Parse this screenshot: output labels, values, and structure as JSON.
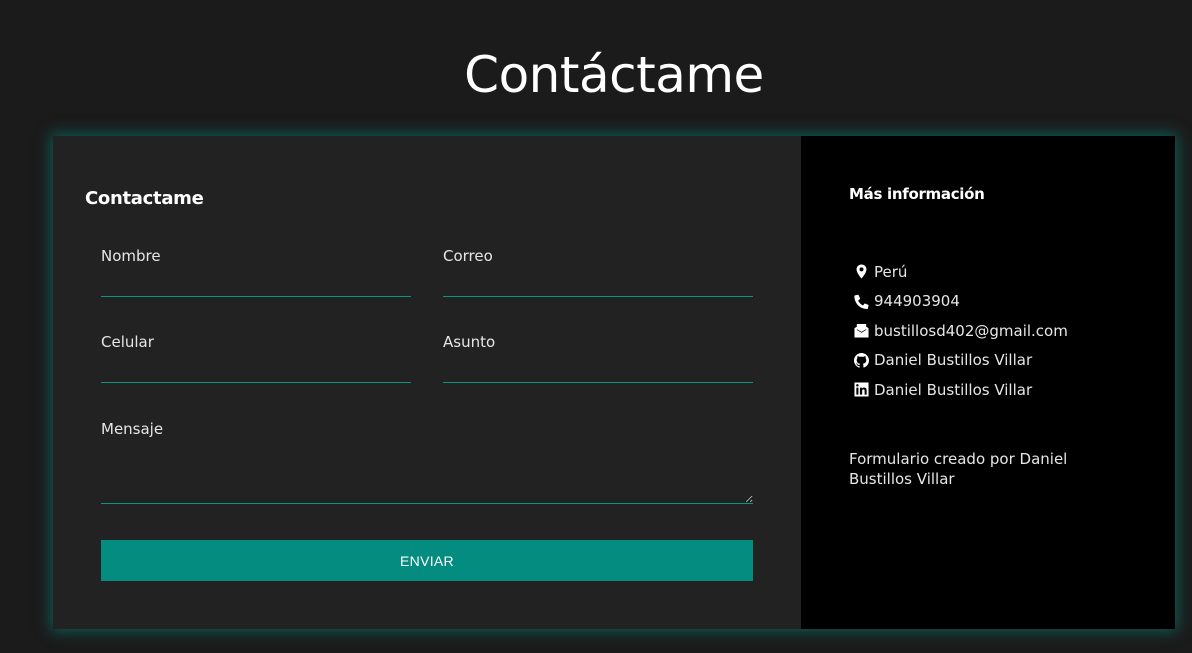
{
  "page": {
    "title": "Contáctame"
  },
  "form": {
    "heading": "Contactame",
    "fields": {
      "nombre": {
        "label": "Nombre",
        "value": ""
      },
      "correo": {
        "label": "Correo",
        "value": ""
      },
      "celular": {
        "label": "Celular",
        "value": ""
      },
      "asunto": {
        "label": "Asunto",
        "value": ""
      },
      "mensaje": {
        "label": "Mensaje",
        "value": ""
      }
    },
    "submit_label": "ENVIAR"
  },
  "info": {
    "heading": "Más información",
    "items": [
      {
        "icon": "location-pin-icon",
        "text": "Perú"
      },
      {
        "icon": "phone-icon",
        "text": "944903904"
      },
      {
        "icon": "mail-icon",
        "text": "bustillosd402@gmail.com"
      },
      {
        "icon": "github-icon",
        "text": "Daniel Bustillos Villar"
      },
      {
        "icon": "linkedin-icon",
        "text": "Daniel Bustillos Villar"
      }
    ],
    "footer": "Formulario creado por Daniel Bustillos Villar"
  },
  "colors": {
    "accent": "#058c80",
    "glow": "#009688",
    "background": "#1b1b1b",
    "form_panel": "#222222",
    "info_panel": "#000000"
  }
}
